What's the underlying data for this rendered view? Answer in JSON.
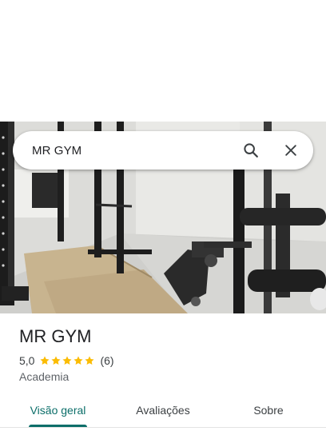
{
  "search": {
    "query": "MR GYM"
  },
  "place": {
    "name": "MR GYM",
    "rating": "5,0",
    "stars": 5,
    "reviews": "(6)",
    "category": "Academia"
  },
  "tabs": [
    {
      "label": "Visão geral",
      "active": true
    },
    {
      "label": "Avaliações",
      "active": false
    },
    {
      "label": "Sobre",
      "active": false
    }
  ],
  "colors": {
    "accent": "#0b6e69",
    "star": "#fbbc04",
    "text": "#202124"
  },
  "icons": {
    "search": "search-icon",
    "close": "close-icon",
    "star": "star-icon"
  }
}
